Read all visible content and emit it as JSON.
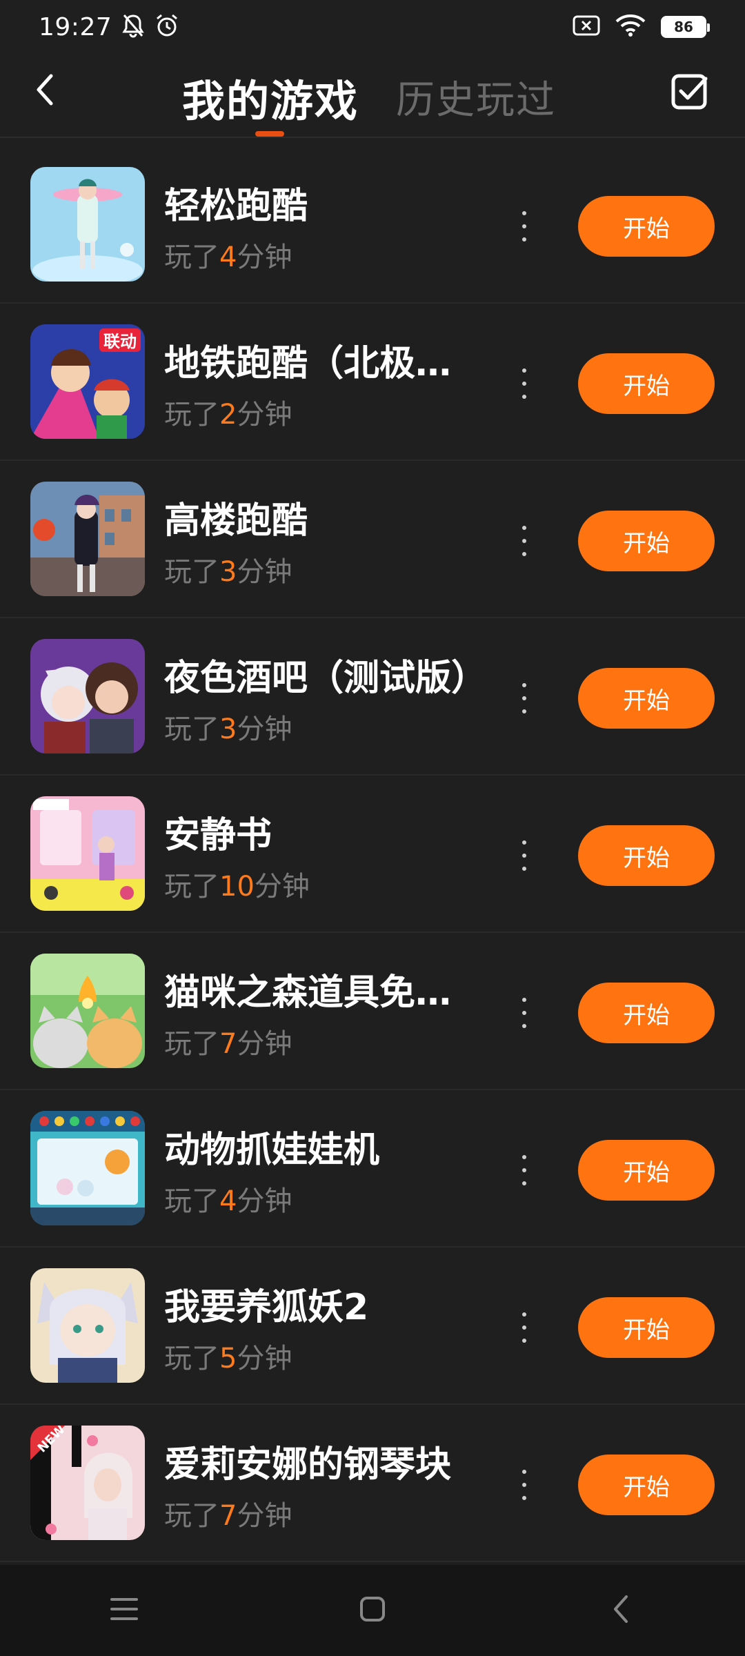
{
  "status": {
    "time": "19:27",
    "battery": "86",
    "icons": [
      "bell-off-icon",
      "alarm-icon",
      "sim-off-icon",
      "wifi-icon",
      "battery-icon"
    ]
  },
  "header": {
    "back_icon": "chevron-left-icon",
    "tab_active": "我的游戏",
    "tab_other": "历史玩过",
    "edit_icon": "checkbox-edit-icon",
    "accent": "#e94e12"
  },
  "games": [
    {
      "title": "轻松跑酷",
      "prefix": "玩了",
      "minutes": "4",
      "suffix": "分钟",
      "button": "开始"
    },
    {
      "title": "地铁跑酷（北极…",
      "prefix": "玩了",
      "minutes": "2",
      "suffix": "分钟",
      "button": "开始"
    },
    {
      "title": "高楼跑酷",
      "prefix": "玩了",
      "minutes": "3",
      "suffix": "分钟",
      "button": "开始"
    },
    {
      "title": "夜色酒吧（测试版）",
      "prefix": "玩了",
      "minutes": "3",
      "suffix": "分钟",
      "button": "开始"
    },
    {
      "title": "安静书",
      "prefix": "玩了",
      "minutes": "10",
      "suffix": "分钟",
      "button": "开始"
    },
    {
      "title": "猫咪之森道具免…",
      "prefix": "玩了",
      "minutes": "7",
      "suffix": "分钟",
      "button": "开始"
    },
    {
      "title": "动物抓娃娃机",
      "prefix": "玩了",
      "minutes": "4",
      "suffix": "分钟",
      "button": "开始"
    },
    {
      "title": "我要养狐妖2",
      "prefix": "玩了",
      "minutes": "5",
      "suffix": "分钟",
      "button": "开始"
    },
    {
      "title": "爱莉安娜的钢琴块",
      "prefix": "玩了",
      "minutes": "7",
      "suffix": "分钟",
      "button": "开始"
    }
  ],
  "thumb_badges": {
    "game_2": "联动",
    "game_9": "NEW"
  },
  "colors": {
    "button": "#ff7410",
    "minutes": "#ff7a1a",
    "background": "#1f1f1f"
  },
  "navbar": {
    "icons": [
      "menu-icon",
      "home-icon",
      "back-icon"
    ]
  }
}
